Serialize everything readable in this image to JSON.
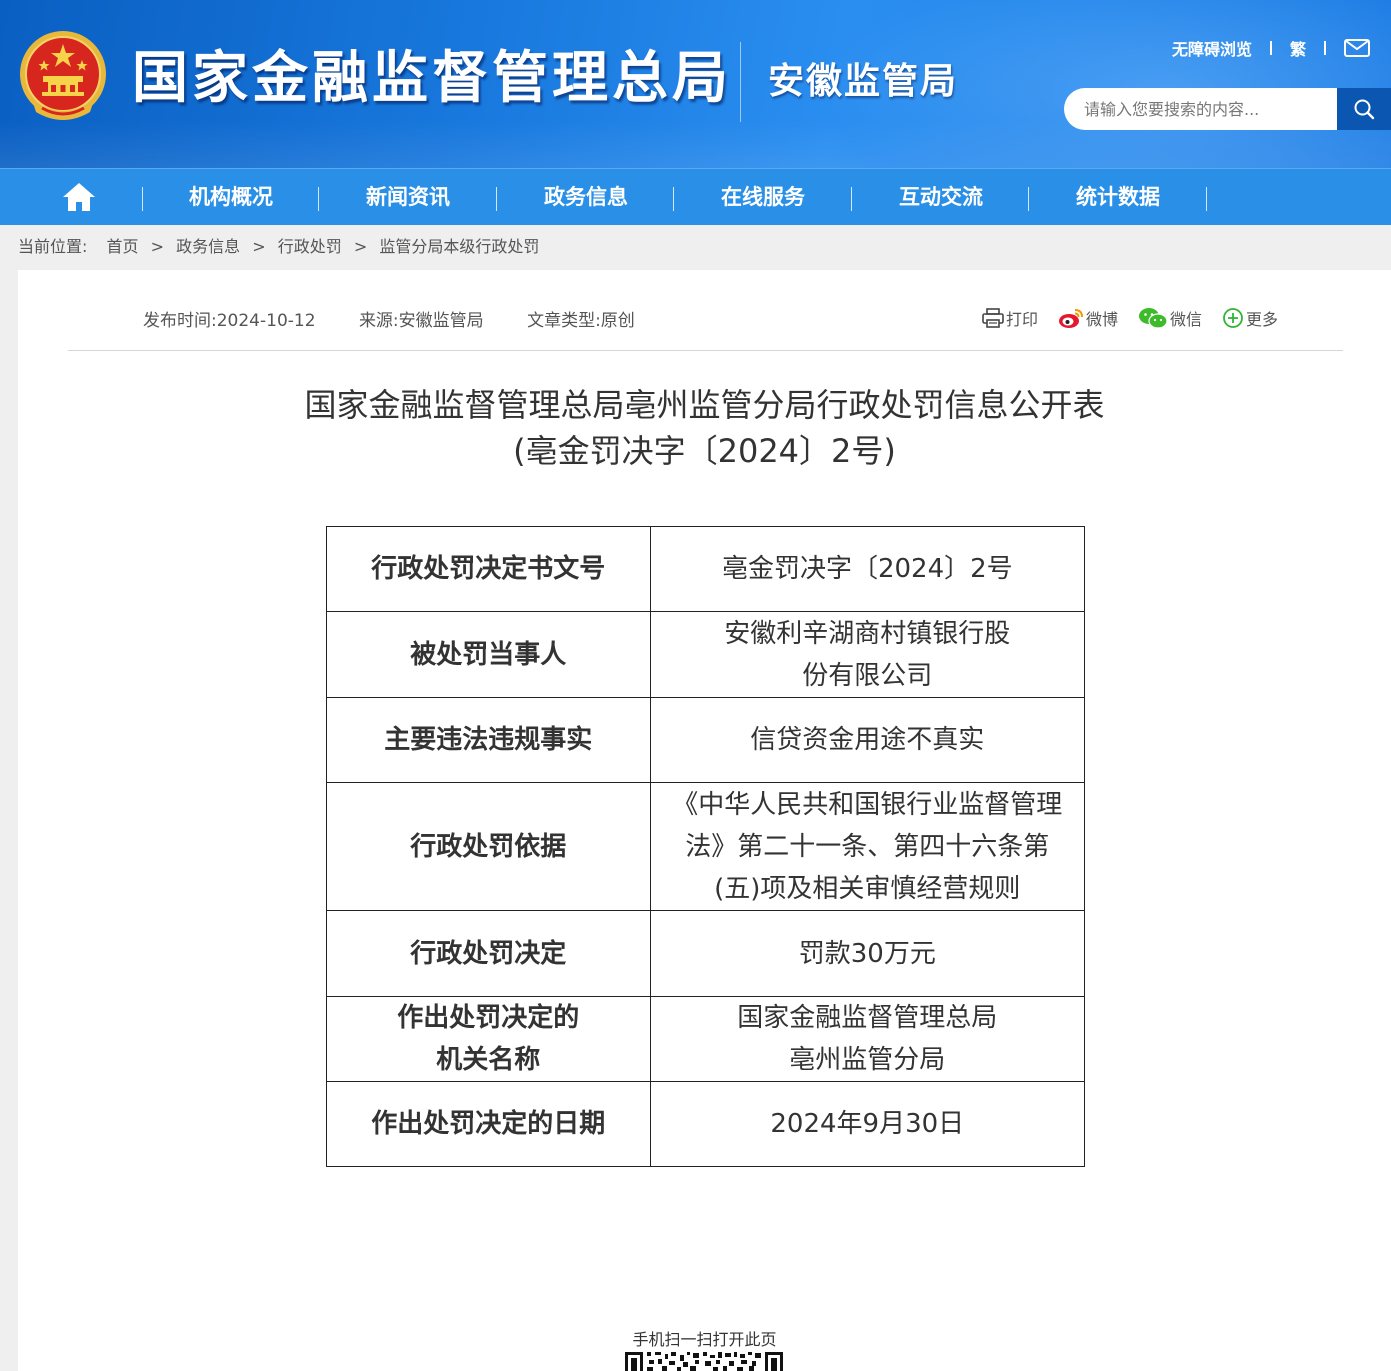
{
  "header": {
    "site_title": "国家金融监督管理总局",
    "sub_title": "安徽监管局",
    "accessibility": "无障碍浏览",
    "traditional": "繁",
    "search_placeholder": "请输入您要搜索的内容..."
  },
  "nav": {
    "items": [
      "机构概况",
      "新闻资讯",
      "政务信息",
      "在线服务",
      "互动交流",
      "统计数据"
    ]
  },
  "breadcrumb": {
    "label": "当前位置:",
    "items": [
      "首页",
      "政务信息",
      "行政处罚",
      "监管分局本级行政处罚"
    ]
  },
  "meta": {
    "publish": "发布时间:2024-10-12",
    "source": "来源:安徽监管局",
    "type": "文章类型:原创"
  },
  "share": {
    "print": "打印",
    "weibo": "微博",
    "wechat": "微信",
    "more": "更多"
  },
  "document": {
    "title_line1": "国家金融监督管理总局亳州监管分局行政处罚信息公开表",
    "title_line2": "(亳金罚决字〔2024〕2号)"
  },
  "table": {
    "rows": [
      {
        "key": "行政处罚决定书文号",
        "value": "亳金罚决字〔2024〕2号"
      },
      {
        "key": "被处罚当事人",
        "value": "安徽利辛湖商村镇银行股份有限公司"
      },
      {
        "key": "主要违法违规事实",
        "value": "信贷资金用途不真实"
      },
      {
        "key": "行政处罚依据",
        "value": "《中华人民共和国银行业监督管理法》第二十一条、第四十六条第(五)项及相关审慎经营规则"
      },
      {
        "key": "行政处罚决定",
        "value": "罚款30万元"
      },
      {
        "key": "作出处罚决定的机关名称",
        "value": "国家金融监督管理总局亳州监管分局"
      },
      {
        "key": "作出处罚决定的日期",
        "value": "2024年9月30日"
      }
    ]
  },
  "footer": {
    "qr_label": "手机扫一扫打开此页"
  }
}
